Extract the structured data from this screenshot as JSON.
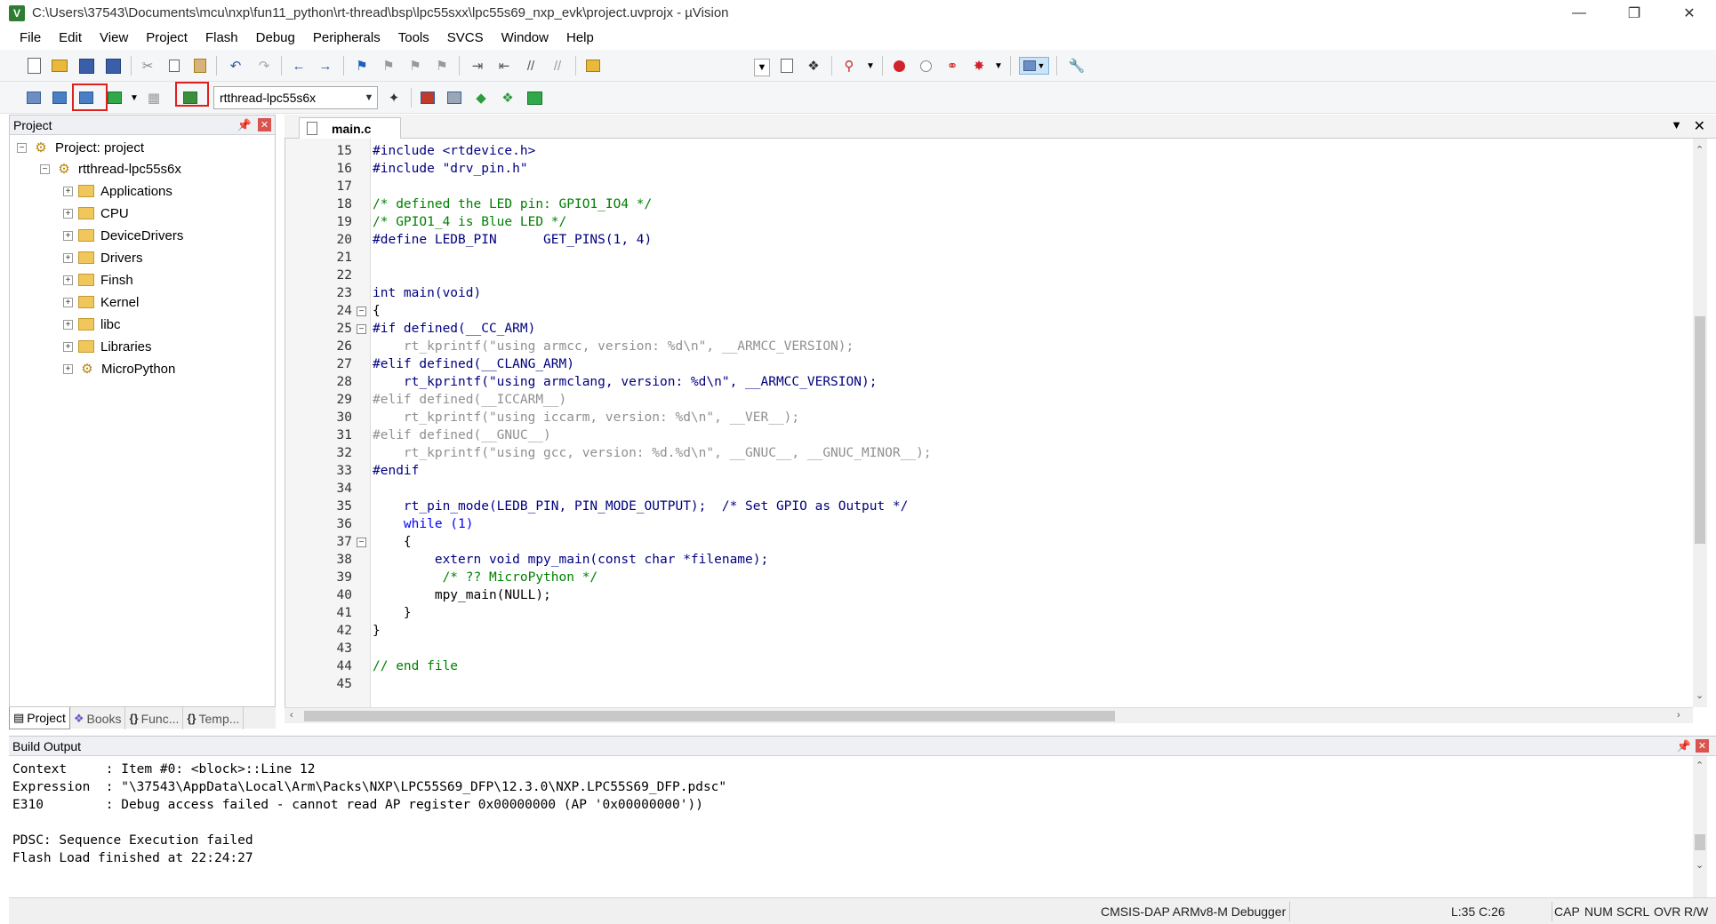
{
  "window": {
    "title": "C:\\Users\\37543\\Documents\\mcu\\nxp\\fun11_python\\rt-thread\\bsp\\lpc55sxx\\lpc55s69_nxp_evk\\project.uvprojx - µVision",
    "icon_letter": "V"
  },
  "menu": [
    "File",
    "Edit",
    "View",
    "Project",
    "Flash",
    "Debug",
    "Peripherals",
    "Tools",
    "SVCS",
    "Window",
    "Help"
  ],
  "toolbar": {
    "target": "rtthread-lpc55s6x"
  },
  "project_panel": {
    "title": "Project",
    "root": "Project: project",
    "target": "rtthread-lpc55s6x",
    "groups": [
      "Applications",
      "CPU",
      "DeviceDrivers",
      "Drivers",
      "Finsh",
      "Kernel",
      "libc",
      "Libraries",
      "MicroPython"
    ],
    "tabs": [
      "Project",
      "Books",
      "Func...",
      "Temp..."
    ]
  },
  "editor": {
    "tab": "main.c",
    "lines": [
      {
        "n": "15",
        "t": "#include <rtdevice.h>"
      },
      {
        "n": "16",
        "t": "#include \"drv_pin.h\""
      },
      {
        "n": "17",
        "t": ""
      },
      {
        "n": "18",
        "t": "/* defined the LED pin: GPIO1_IO4 */"
      },
      {
        "n": "19",
        "t": "/* GPIO1_4 is Blue LED */"
      },
      {
        "n": "20",
        "t": "#define LEDB_PIN      GET_PINS(1, 4)"
      },
      {
        "n": "21",
        "t": ""
      },
      {
        "n": "22",
        "t": ""
      },
      {
        "n": "23",
        "t": "int main(void)"
      },
      {
        "n": "24",
        "t": "{"
      },
      {
        "n": "25",
        "t": "#if defined(__CC_ARM)"
      },
      {
        "n": "26",
        "t": "    rt_kprintf(\"using armcc, version: %d\\n\", __ARMCC_VERSION);"
      },
      {
        "n": "27",
        "t": "#elif defined(__CLANG_ARM)"
      },
      {
        "n": "28",
        "t": "    rt_kprintf(\"using armclang, version: %d\\n\", __ARMCC_VERSION);"
      },
      {
        "n": "29",
        "t": "#elif defined(__ICCARM__)"
      },
      {
        "n": "30",
        "t": "    rt_kprintf(\"using iccarm, version: %d\\n\", __VER__);"
      },
      {
        "n": "31",
        "t": "#elif defined(__GNUC__)"
      },
      {
        "n": "32",
        "t": "    rt_kprintf(\"using gcc, version: %d.%d\\n\", __GNUC__, __GNUC_MINOR__);"
      },
      {
        "n": "33",
        "t": "#endif"
      },
      {
        "n": "34",
        "t": ""
      },
      {
        "n": "35",
        "t": "    rt_pin_mode(LEDB_PIN, PIN_MODE_OUTPUT);  /* Set GPIO as Output */"
      },
      {
        "n": "36",
        "t": "    while (1)"
      },
      {
        "n": "37",
        "t": "    {"
      },
      {
        "n": "38",
        "t": "        extern void mpy_main(const char *filename);"
      },
      {
        "n": "39",
        "t": "         /* ?? MicroPython */"
      },
      {
        "n": "40",
        "t": "        mpy_main(NULL);"
      },
      {
        "n": "41",
        "t": "    }"
      },
      {
        "n": "42",
        "t": "}"
      },
      {
        "n": "43",
        "t": ""
      },
      {
        "n": "44",
        "t": "// end file"
      },
      {
        "n": "45",
        "t": ""
      }
    ]
  },
  "build_output": {
    "title": "Build Output",
    "lines": [
      "Context     : Item #0: <block>::Line 12",
      "Expression  : \"\\37543\\AppData\\Local\\Arm\\Packs\\NXP\\LPC55S69_DFP\\12.3.0\\NXP.LPC55S69_DFP.pdsc\"",
      "E310        : Debug access failed - cannot read AP register 0x00000000 (AP '0x00000000'))",
      "",
      "PDSC: Sequence Execution failed",
      "Flash Load finished at 22:24:27"
    ]
  },
  "status": {
    "debugger": "CMSIS-DAP ARMv8-M Debugger",
    "position": "L:35 C:26",
    "cap": "CAP",
    "num": "NUM",
    "scrl": "SCRL",
    "ovr": "OVR",
    "rw": "R/W"
  },
  "colors": {
    "highlight": "#e01f1f",
    "keyword": "#0000ff",
    "comment": "#008000",
    "string": "#a31515"
  }
}
